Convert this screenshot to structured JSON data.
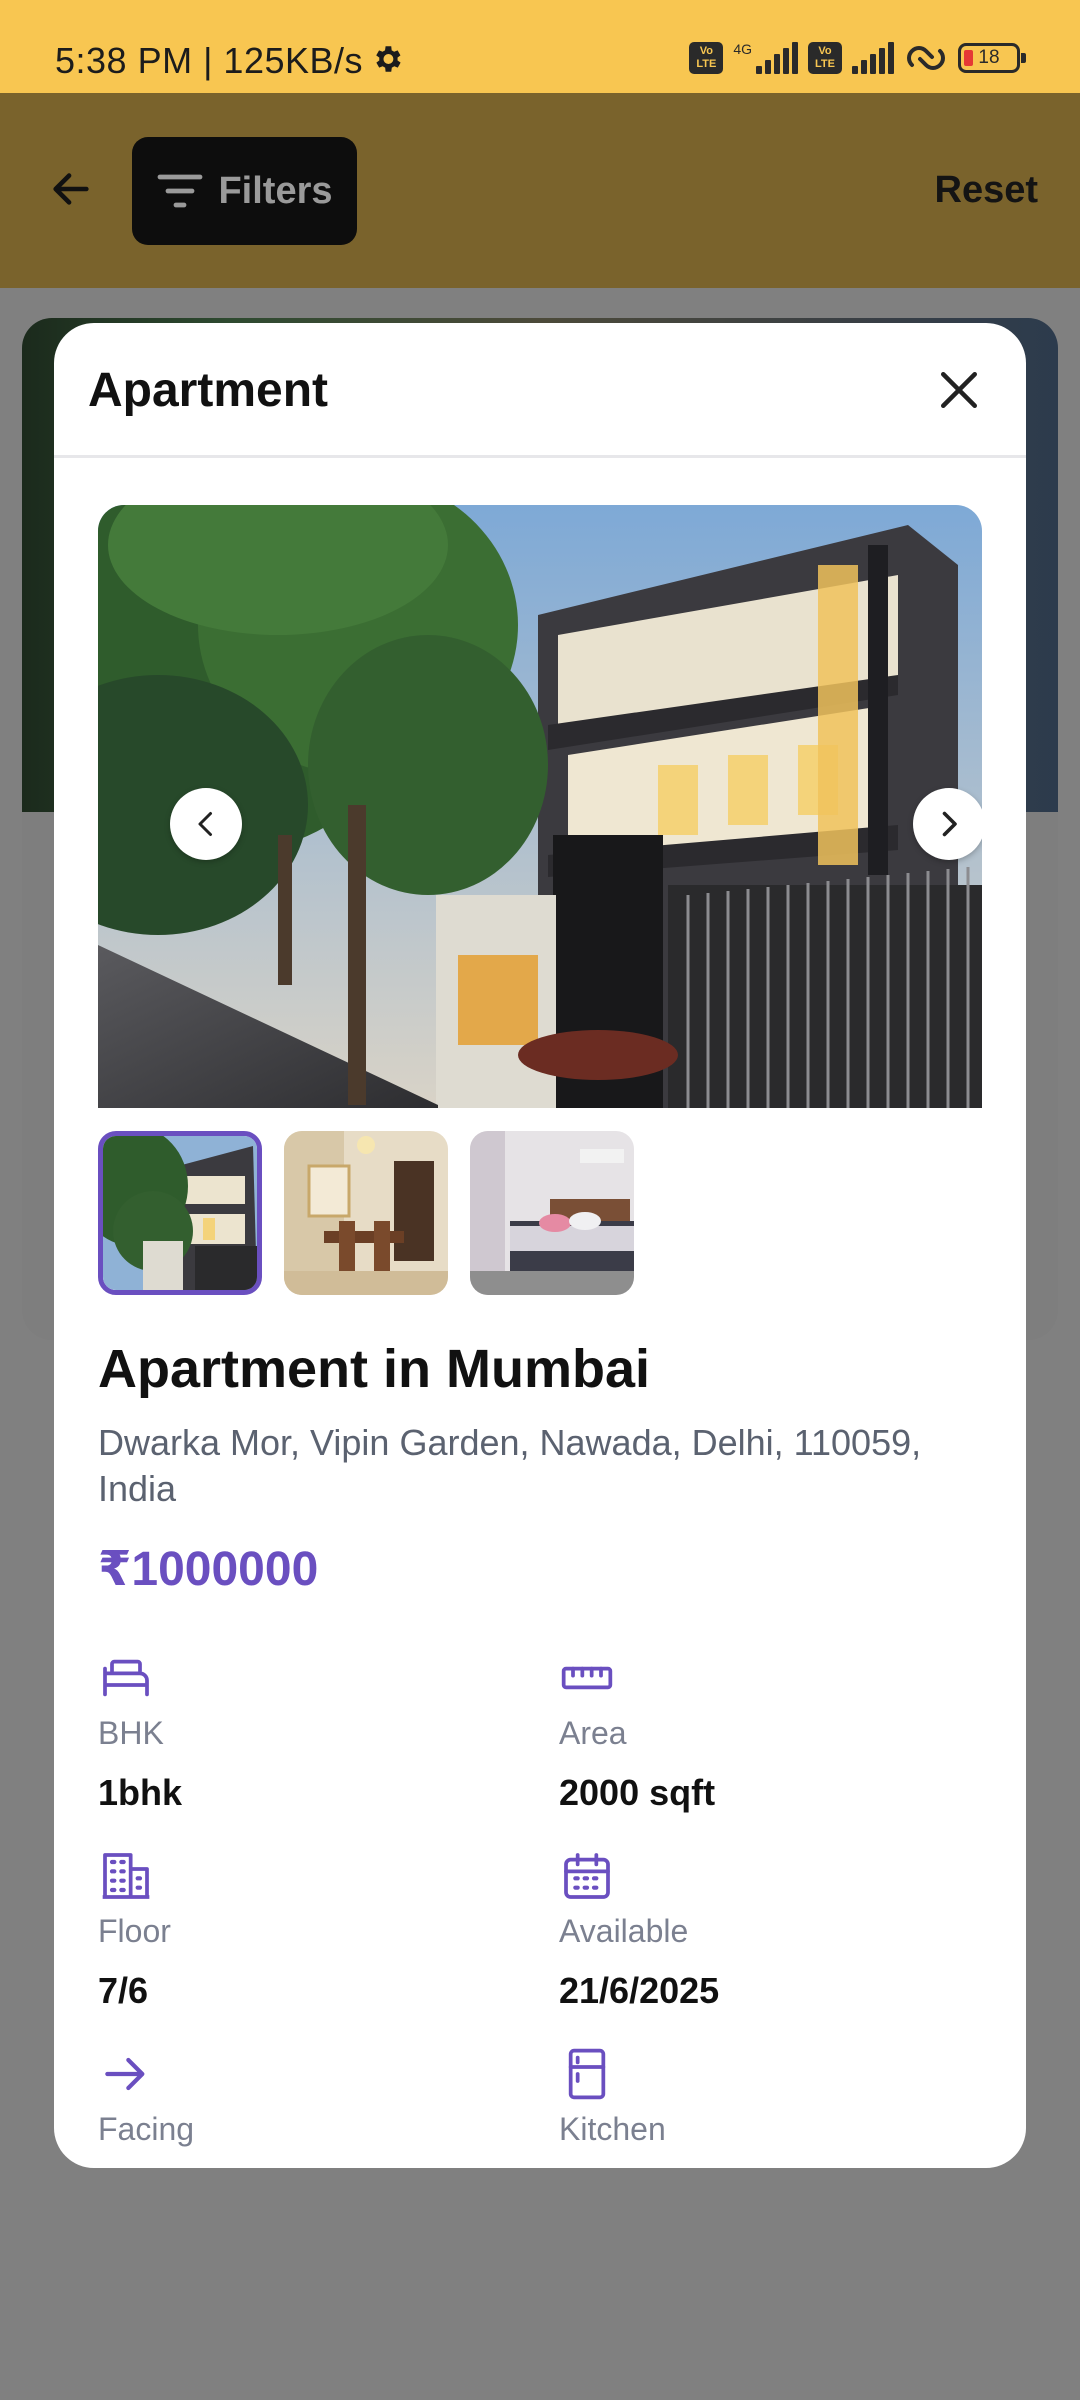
{
  "status": {
    "time_speed": "5:38 PM | 125KB/s",
    "network": "4G",
    "volte": "Vo LTE",
    "battery": "18"
  },
  "header": {
    "filters_label": "Filters",
    "reset_label": "Reset"
  },
  "modal": {
    "title": "Apartment",
    "property": {
      "title": "Apartment in Mumbai",
      "address": "Dwarka Mor, Vipin Garden, Nawada, Delhi, 110059, India",
      "price": "₹1000000"
    },
    "specs": [
      {
        "label": "BHK",
        "value": "1bhk",
        "icon": "bed-icon"
      },
      {
        "label": "Area",
        "value": "2000 sqft",
        "icon": "ruler-icon"
      },
      {
        "label": "Floor",
        "value": "7/6",
        "icon": "building-icon"
      },
      {
        "label": "Available",
        "value": "21/6/2025",
        "icon": "calendar-icon"
      },
      {
        "label": "Facing",
        "value": "",
        "icon": "arrow-right-icon"
      },
      {
        "label": "Kitchen",
        "value": "",
        "icon": "kitchen-icon"
      }
    ],
    "thumbnails": [
      "exterior",
      "dining room",
      "bedroom"
    ],
    "active_thumbnail": 0
  },
  "colors": {
    "accent": "#6a4fc0",
    "status_bar": "#f8c651",
    "app_bar": "#7a632c"
  }
}
